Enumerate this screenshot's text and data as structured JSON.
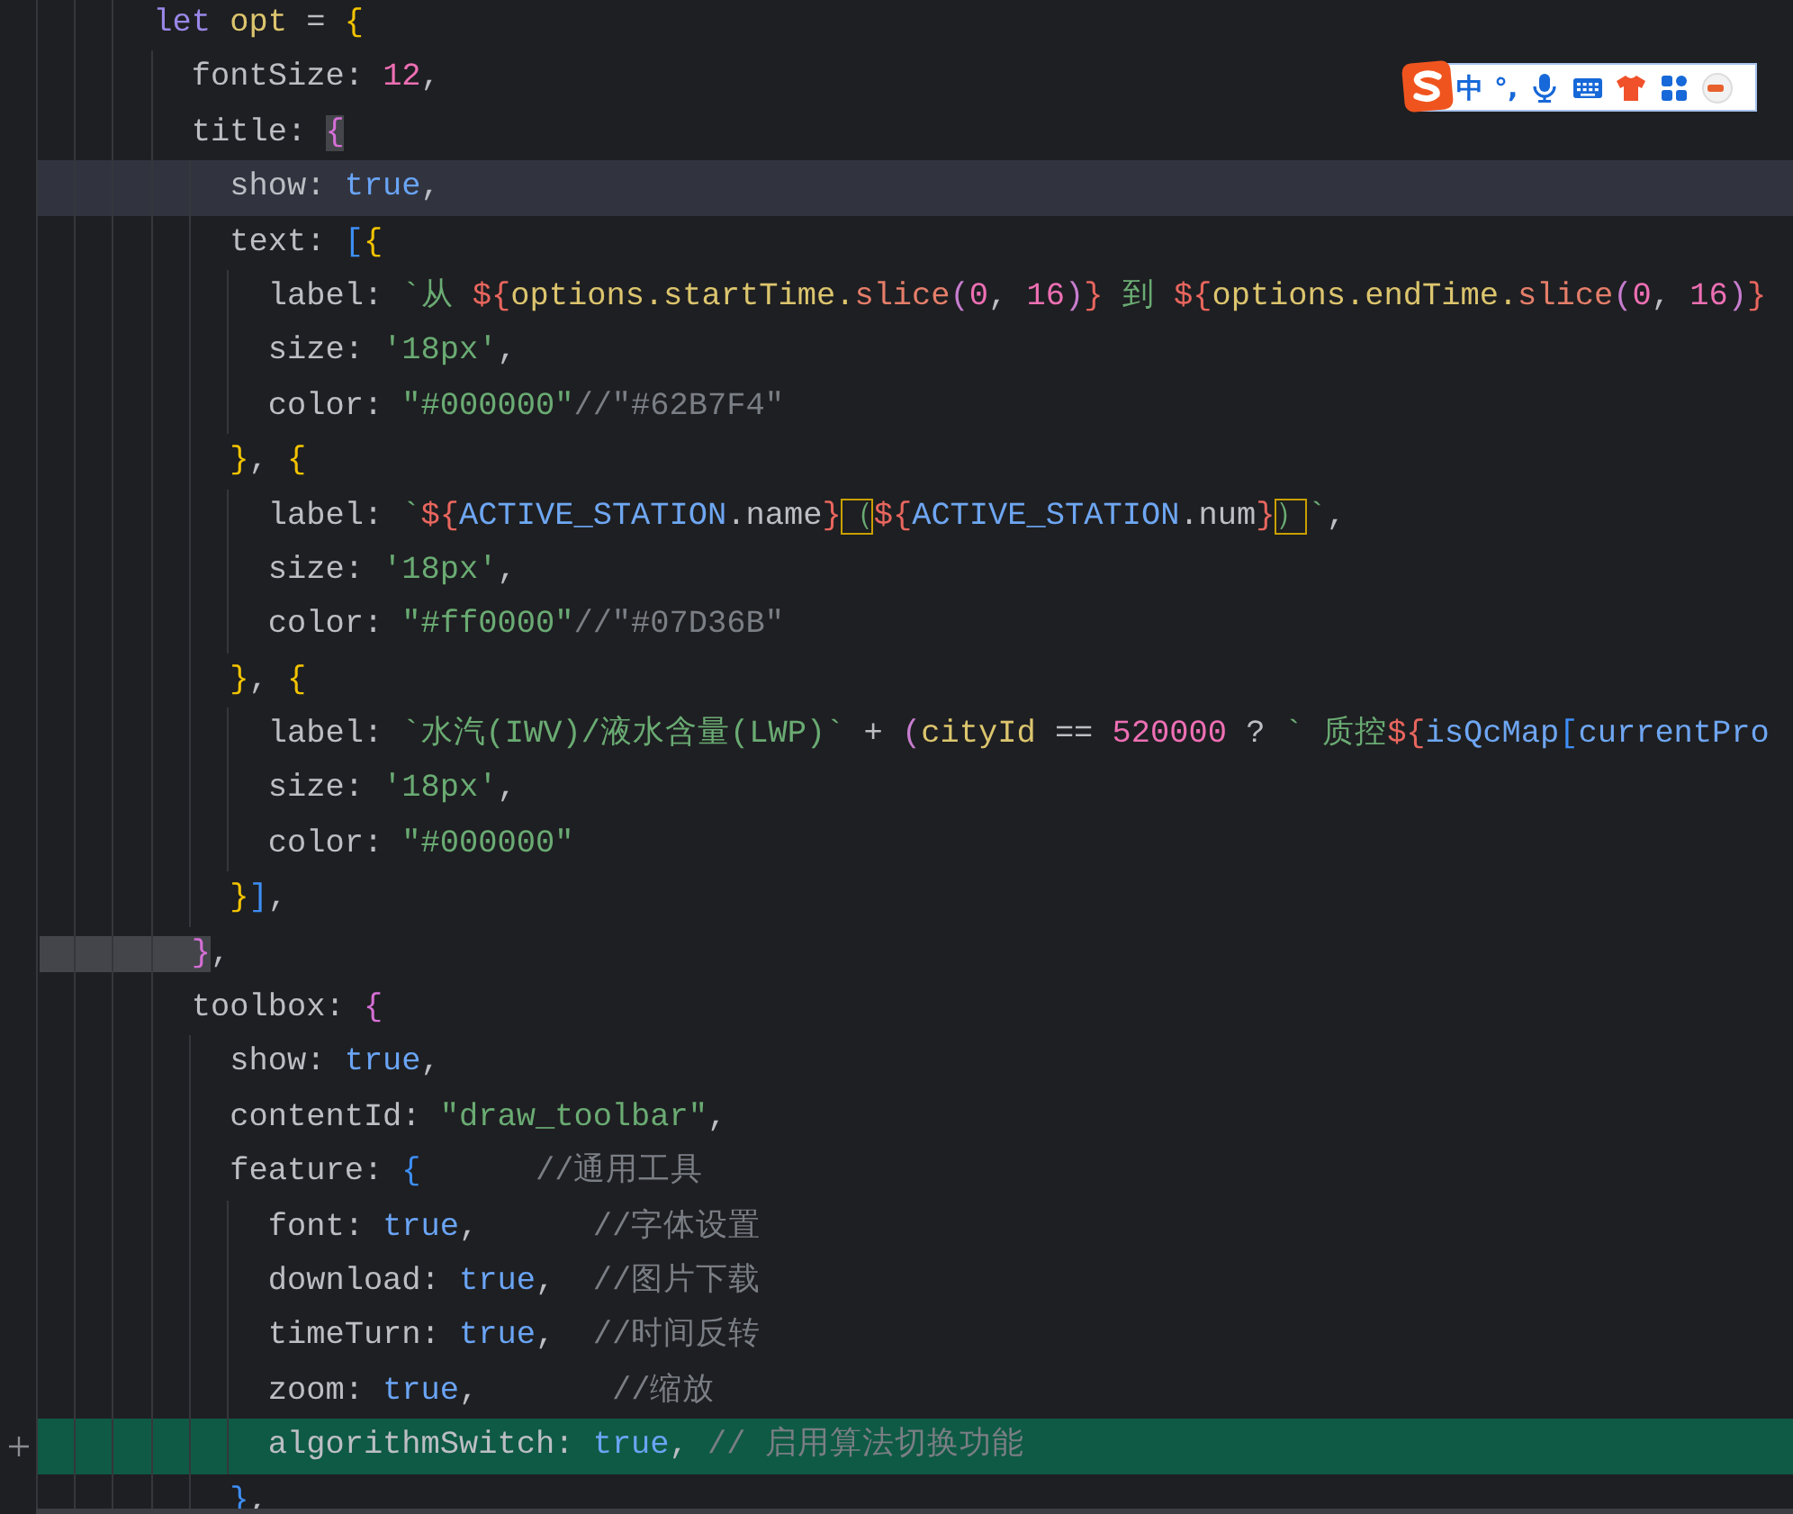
{
  "editor": {
    "lines": [
      {
        "current": false,
        "added": false,
        "tokens": [
          {
            "text": "      let",
            "kind": "kw"
          },
          {
            "text": " opt",
            "kind": "var"
          },
          {
            "text": " = ",
            "kind": "plain"
          },
          {
            "text": "{",
            "kind": "b1"
          }
        ]
      },
      {
        "current": false,
        "added": false,
        "tokens": [
          {
            "text": "        fontSize: ",
            "kind": "plain"
          },
          {
            "text": "12",
            "kind": "num"
          },
          {
            "text": ",",
            "kind": "plain"
          }
        ]
      },
      {
        "current": false,
        "added": false,
        "tokens": [
          {
            "text": "        title: ",
            "kind": "plain"
          },
          {
            "text": "{",
            "kind": "b2-match"
          }
        ]
      },
      {
        "current": true,
        "added": false,
        "tokens": [
          {
            "text": "          show: ",
            "kind": "plain"
          },
          {
            "text": "true",
            "kind": "bool"
          },
          {
            "text": ",",
            "kind": "plain"
          }
        ]
      },
      {
        "current": false,
        "added": false,
        "tokens": [
          {
            "text": "          text: ",
            "kind": "plain"
          },
          {
            "text": "[",
            "kind": "b3"
          },
          {
            "text": "{",
            "kind": "b1"
          }
        ]
      },
      {
        "current": false,
        "added": false,
        "tokens": [
          {
            "text": "            label: ",
            "kind": "plain"
          },
          {
            "text": "`从 ",
            "kind": "str"
          },
          {
            "text": "${",
            "kind": "interp"
          },
          {
            "text": "options.startTime.",
            "kind": "var"
          },
          {
            "text": "slice",
            "kind": "method"
          },
          {
            "text": "(",
            "kind": "paren"
          },
          {
            "text": "0",
            "kind": "num"
          },
          {
            "text": ", ",
            "kind": "plain"
          },
          {
            "text": "16",
            "kind": "num"
          },
          {
            "text": ")",
            "kind": "paren"
          },
          {
            "text": "}",
            "kind": "interp"
          },
          {
            "text": " 到 ",
            "kind": "str"
          },
          {
            "text": "${",
            "kind": "interp"
          },
          {
            "text": "options.endTime.",
            "kind": "var"
          },
          {
            "text": "slice",
            "kind": "method"
          },
          {
            "text": "(",
            "kind": "paren"
          },
          {
            "text": "0",
            "kind": "num"
          },
          {
            "text": ", ",
            "kind": "plain"
          },
          {
            "text": "16",
            "kind": "num"
          },
          {
            "text": ")",
            "kind": "paren"
          },
          {
            "text": "}",
            "kind": "interp"
          }
        ]
      },
      {
        "current": false,
        "added": false,
        "tokens": [
          {
            "text": "            size: ",
            "kind": "plain"
          },
          {
            "text": "'18px'",
            "kind": "str"
          },
          {
            "text": ",",
            "kind": "plain"
          }
        ]
      },
      {
        "current": false,
        "added": false,
        "tokens": [
          {
            "text": "            color: ",
            "kind": "plain"
          },
          {
            "text": "\"#000000\"",
            "kind": "str"
          },
          {
            "text": "//\"#62B7F4\"",
            "kind": "cmt"
          }
        ]
      },
      {
        "current": false,
        "added": false,
        "tokens": [
          {
            "text": "          }",
            "kind": "b1"
          },
          {
            "text": ", ",
            "kind": "plain"
          },
          {
            "text": "{",
            "kind": "b1"
          }
        ]
      },
      {
        "current": false,
        "added": false,
        "tokens": [
          {
            "text": "            label: ",
            "kind": "plain"
          },
          {
            "text": "`",
            "kind": "str"
          },
          {
            "text": "${",
            "kind": "interp"
          },
          {
            "text": "ACTIVE_STATION",
            "kind": "const"
          },
          {
            "text": ".name",
            "kind": "plain"
          },
          {
            "text": "}",
            "kind": "interp"
          },
          {
            "text": "（",
            "kind": "str-box"
          },
          {
            "text": "${",
            "kind": "interp"
          },
          {
            "text": "ACTIVE_STATION",
            "kind": "const"
          },
          {
            "text": ".num",
            "kind": "plain"
          },
          {
            "text": "}",
            "kind": "interp"
          },
          {
            "text": "）",
            "kind": "str-box"
          },
          {
            "text": "`",
            "kind": "str"
          },
          {
            "text": ",",
            "kind": "plain"
          }
        ]
      },
      {
        "current": false,
        "added": false,
        "tokens": [
          {
            "text": "            size: ",
            "kind": "plain"
          },
          {
            "text": "'18px'",
            "kind": "str"
          },
          {
            "text": ",",
            "kind": "plain"
          }
        ]
      },
      {
        "current": false,
        "added": false,
        "tokens": [
          {
            "text": "            color: ",
            "kind": "plain"
          },
          {
            "text": "\"#ff0000\"",
            "kind": "str"
          },
          {
            "text": "//\"#07D36B\"",
            "kind": "cmt"
          }
        ]
      },
      {
        "current": false,
        "added": false,
        "tokens": [
          {
            "text": "          }",
            "kind": "b1"
          },
          {
            "text": ", ",
            "kind": "plain"
          },
          {
            "text": "{",
            "kind": "b1"
          }
        ]
      },
      {
        "current": false,
        "added": false,
        "tokens": [
          {
            "text": "            label: ",
            "kind": "plain"
          },
          {
            "text": "`水汽(IWV)/液水含量(LWP)`",
            "kind": "str"
          },
          {
            "text": " + ",
            "kind": "plain"
          },
          {
            "text": "(",
            "kind": "paren"
          },
          {
            "text": "cityId",
            "kind": "var"
          },
          {
            "text": " == ",
            "kind": "plain"
          },
          {
            "text": "520000",
            "kind": "num"
          },
          {
            "text": " ? ",
            "kind": "plain"
          },
          {
            "text": "` 质控",
            "kind": "str"
          },
          {
            "text": "${",
            "kind": "interp"
          },
          {
            "text": "isQcMap",
            "kind": "const"
          },
          {
            "text": "[",
            "kind": "b3"
          },
          {
            "text": "currentPro",
            "kind": "const"
          }
        ]
      },
      {
        "current": false,
        "added": false,
        "tokens": [
          {
            "text": "            size: ",
            "kind": "plain"
          },
          {
            "text": "'18px'",
            "kind": "str"
          },
          {
            "text": ",",
            "kind": "plain"
          }
        ]
      },
      {
        "current": false,
        "added": false,
        "tokens": [
          {
            "text": "            color: ",
            "kind": "plain"
          },
          {
            "text": "\"#000000\"",
            "kind": "str"
          }
        ]
      },
      {
        "current": false,
        "added": false,
        "tokens": [
          {
            "text": "          }",
            "kind": "b1"
          },
          {
            "text": "]",
            "kind": "b3"
          },
          {
            "text": ",",
            "kind": "plain"
          }
        ]
      },
      {
        "current": false,
        "added": false,
        "tokens": [
          {
            "text": "        }",
            "kind": "b2-match"
          },
          {
            "text": ",",
            "kind": "plain"
          }
        ]
      },
      {
        "current": false,
        "added": false,
        "tokens": [
          {
            "text": "        toolbox: ",
            "kind": "plain"
          },
          {
            "text": "{",
            "kind": "b2"
          }
        ]
      },
      {
        "current": false,
        "added": false,
        "tokens": [
          {
            "text": "          show: ",
            "kind": "plain"
          },
          {
            "text": "true",
            "kind": "bool"
          },
          {
            "text": ",",
            "kind": "plain"
          }
        ]
      },
      {
        "current": false,
        "added": false,
        "tokens": [
          {
            "text": "          contentId: ",
            "kind": "plain"
          },
          {
            "text": "\"draw_toolbar\"",
            "kind": "str"
          },
          {
            "text": ",",
            "kind": "plain"
          }
        ]
      },
      {
        "current": false,
        "added": false,
        "tokens": [
          {
            "text": "          feature: ",
            "kind": "plain"
          },
          {
            "text": "{",
            "kind": "b3"
          },
          {
            "text": "      //通用工具",
            "kind": "cmt"
          }
        ]
      },
      {
        "current": false,
        "added": false,
        "tokens": [
          {
            "text": "            font: ",
            "kind": "plain"
          },
          {
            "text": "true",
            "kind": "bool"
          },
          {
            "text": ",      ",
            "kind": "plain"
          },
          {
            "text": "//字体设置",
            "kind": "cmt"
          }
        ]
      },
      {
        "current": false,
        "added": false,
        "tokens": [
          {
            "text": "            download: ",
            "kind": "plain"
          },
          {
            "text": "true",
            "kind": "bool"
          },
          {
            "text": ",  ",
            "kind": "plain"
          },
          {
            "text": "//图片下载",
            "kind": "cmt"
          }
        ]
      },
      {
        "current": false,
        "added": false,
        "tokens": [
          {
            "text": "            timeTurn: ",
            "kind": "plain"
          },
          {
            "text": "true",
            "kind": "bool"
          },
          {
            "text": ",  ",
            "kind": "plain"
          },
          {
            "text": "//时间反转",
            "kind": "cmt"
          }
        ]
      },
      {
        "current": false,
        "added": false,
        "tokens": [
          {
            "text": "            zoom: ",
            "kind": "plain"
          },
          {
            "text": "true",
            "kind": "bool"
          },
          {
            "text": ",       ",
            "kind": "plain"
          },
          {
            "text": "//缩放",
            "kind": "cmt"
          }
        ]
      },
      {
        "current": false,
        "added": true,
        "tokens": [
          {
            "text": "            algorithmSwitch: ",
            "kind": "plain"
          },
          {
            "text": "true",
            "kind": "bool"
          },
          {
            "text": ", ",
            "kind": "plain"
          },
          {
            "text": "// 启用算法切换功能",
            "kind": "cmt"
          }
        ]
      },
      {
        "current": false,
        "added": false,
        "tokens": [
          {
            "text": "          }",
            "kind": "b3"
          },
          {
            "text": ",",
            "kind": "plain"
          }
        ]
      }
    ]
  },
  "ime_toolbar": {
    "mode": "中",
    "punctuation": "°,"
  }
}
